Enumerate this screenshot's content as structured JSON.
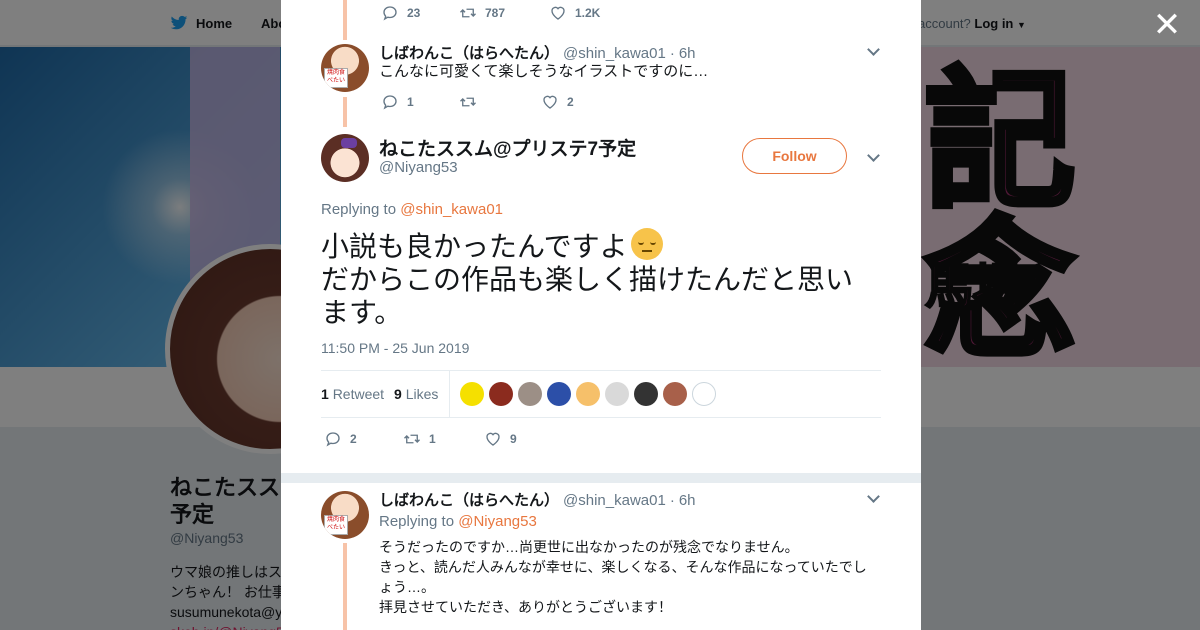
{
  "background": {
    "nav": {
      "home_label": "Home",
      "about_label": "Abo",
      "account_prompt": "account?",
      "login_label": "Log in"
    },
    "profile": {
      "name_line1": "ねこたスス",
      "name_line2": "予定",
      "handle": "@Niyang53",
      "bio_line1": "ウマ娘の推しはス",
      "bio_line2": "ンちゃん！ お仕事",
      "bio_line3": "susumunekota@y",
      "bio_line4": "skeb.jp/@Niyang5"
    },
    "banner_text": {
      "big": "記念",
      "small": "馬場"
    }
  },
  "modal": {
    "close_label": "✕",
    "prev_tweet_actions": {
      "replies": "23",
      "retweets": "787",
      "likes": "1.2K"
    },
    "reply_above": {
      "name": "しばわんこ（はらへたん）",
      "handle": "@shin_kawa01",
      "time": "6h",
      "text": "こんなに可愛くて楽しそうなイラストですのに…",
      "avatar_tag": "焼肉食べたい",
      "replies": "1",
      "retweets": "",
      "likes": "2"
    },
    "main_tweet": {
      "name": "ねこたススム@プリステ7予定",
      "handle": "@Niyang53",
      "follow_label": "Follow",
      "replying_prefix": "Replying to",
      "replying_to": "@shin_kawa01",
      "text_line1": "小説も良かったんですよ",
      "text_line2": "だからこの作品も楽しく描けたんだと思い",
      "text_line3": "ます。",
      "timestamp": "11:50 PM - 25 Jun 2019",
      "retweet_count": "1",
      "retweet_label": "Retweet",
      "like_count": "9",
      "like_label": "Likes",
      "replies": "2",
      "retweets": "1",
      "likes": "9",
      "liker_colors": [
        "#f5e000",
        "#8b2b1e",
        "#9c8f86",
        "#2c4fa8",
        "#f6c06a",
        "#d9d9d9",
        "#333333",
        "#a8604a",
        "#ffffff"
      ]
    },
    "reply_below": {
      "name": "しばわんこ（はらへたん）",
      "handle": "@shin_kawa01",
      "time": "6h",
      "replying_prefix": "Replying to",
      "replying_to": "@Niyang53",
      "text_line1": "そうだったのですか…尚更世に出なかったのが残念でなりません。",
      "text_line2": "きっと、読んだ人みんなが幸せに、楽しくなる、そんな作品になっていたでし",
      "text_line3": "ょう…。",
      "text_line4": "拝見させていただき、ありがとうございます！",
      "avatar_tag": "焼肉食べたい"
    }
  }
}
